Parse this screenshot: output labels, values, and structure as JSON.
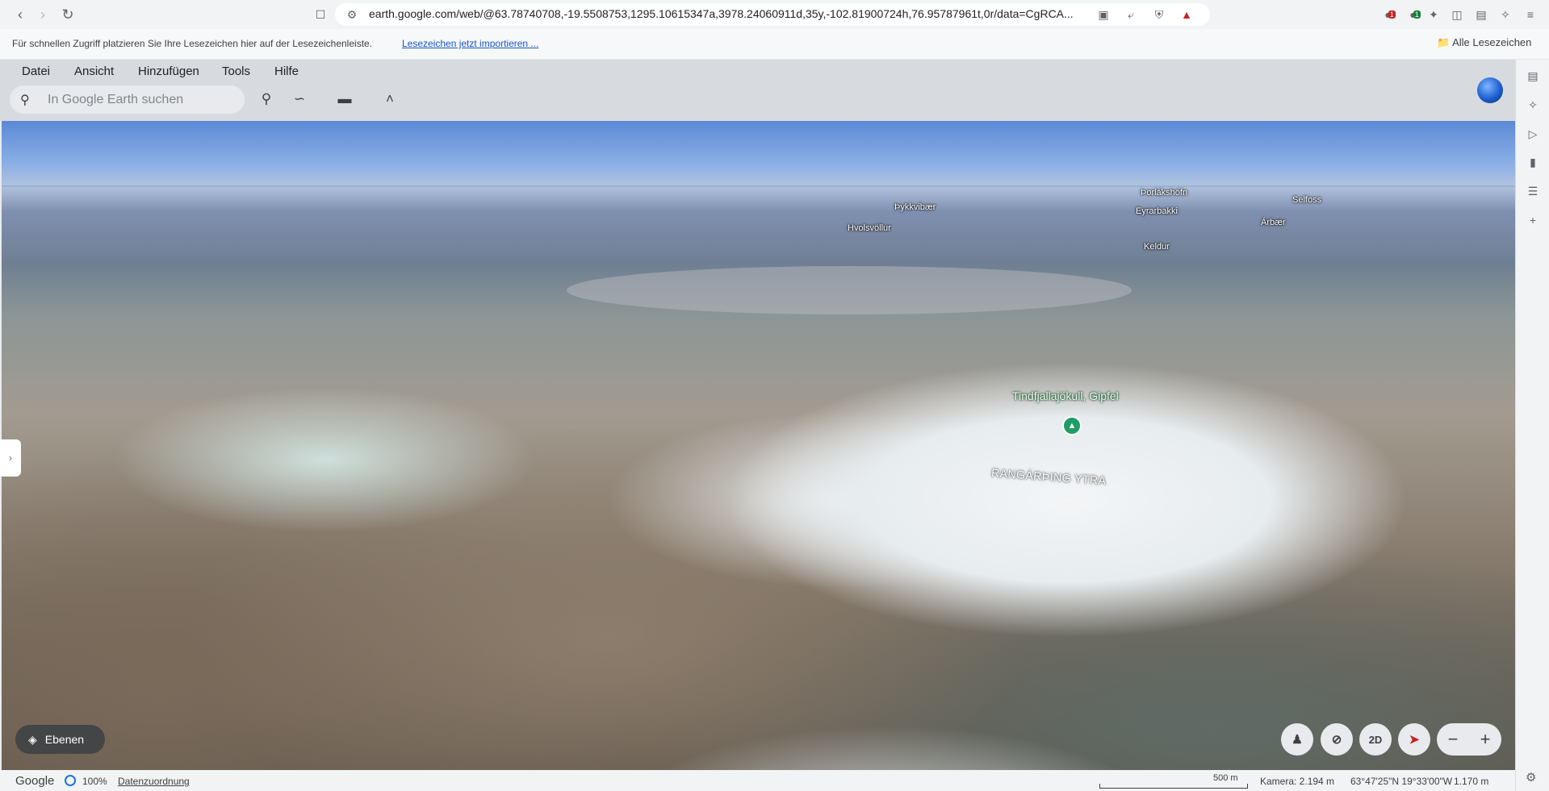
{
  "browser": {
    "url": "earth.google.com/web/@63.78740708,-19.5508753,1295.10615347a,3978.24060911d,35y,-102.81900724h,76.95787961t,0r/data=CgRCA...",
    "nav_icons": [
      "back-arrow-icon",
      "forward-arrow-icon",
      "reload-icon"
    ],
    "extension_badges": [
      "1",
      "1"
    ]
  },
  "bookmarks_bar": {
    "hint": "Für schnellen Zugriff platzieren Sie Ihre Lesezeichen hier auf der Lesezeichenleiste.",
    "import_link": "Lesezeichen jetzt importieren ...",
    "all_bookmarks": "Alle Lesezeichen"
  },
  "menu": {
    "items": [
      "Datei",
      "Ansicht",
      "Hinzufügen",
      "Tools",
      "Hilfe"
    ]
  },
  "search": {
    "placeholder": "In Google Earth suchen"
  },
  "map": {
    "summit_label": "Tindfjallajökull, Gipfel",
    "region_label": "RANGÁRÞING YTRA",
    "places": [
      "Þykkvibær",
      "Hvolsvöllur",
      "Þorlákshöfn",
      "Eyrarbakki",
      "Keldur",
      "Selfoss",
      "Árbær"
    ]
  },
  "controls": {
    "layers_label": "Ebenen",
    "view_2d_label": "2D"
  },
  "statusbar": {
    "brand": "Google",
    "progress": "100%",
    "attribution": "Datenzuordnung",
    "scale": "500 m",
    "camera": "Kamera: 2.194 m",
    "coords": "63°47'25\"N 19°33'00\"W",
    "elevation": "1.170 m"
  }
}
